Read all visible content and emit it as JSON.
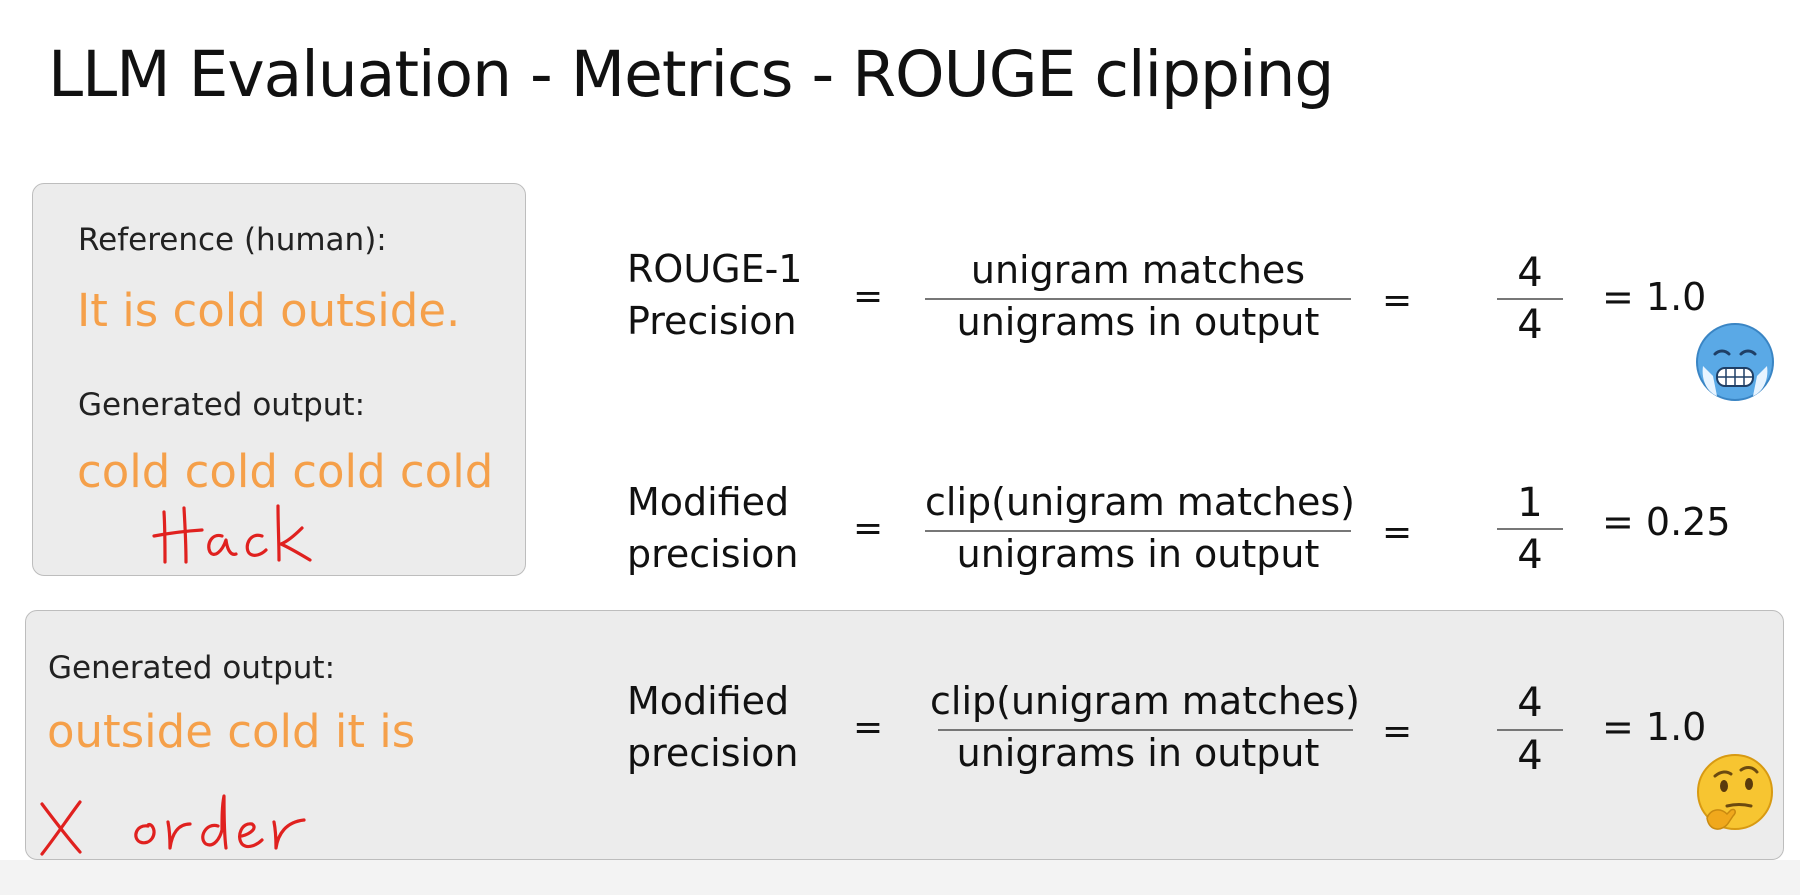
{
  "title": "LLM Evaluation - Metrics - ROUGE clipping",
  "top_box": {
    "reference_label": "Reference (human):",
    "reference_text": "It is cold outside.",
    "generated_label": "Generated output:",
    "generated_text": "cold cold cold cold",
    "annotation": "Hack"
  },
  "bottom_box": {
    "generated_label": "Generated output:",
    "generated_text": "outside cold it is",
    "annotation": "X order"
  },
  "rows": [
    {
      "label_line1": "ROUGE-1",
      "label_line2": "Precision",
      "equals": "=",
      "numerator": "unigram matches",
      "denominator": "unigrams in output",
      "equals2": "=",
      "num_value": "4",
      "den_value": "4",
      "result": "= 1.0",
      "emoji": "cold-face-emoji"
    },
    {
      "label_line1": "Modified",
      "label_line2": "precision",
      "equals": "=",
      "numerator": "clip(unigram matches)",
      "denominator": "unigrams in output",
      "equals2": "=",
      "num_value": "1",
      "den_value": "4",
      "result": "= 0.25"
    },
    {
      "label_line1": "Modified",
      "label_line2": "precision",
      "equals": "=",
      "numerator": "clip(unigram matches)",
      "denominator": "unigrams in output",
      "equals2": "=",
      "num_value": "4",
      "den_value": "4",
      "result": "= 1.0",
      "emoji": "thinking-face-emoji"
    }
  ],
  "colors": {
    "highlight_text": "#f5a04a",
    "handwriting": "#e0211f",
    "panel_background": "#ececec",
    "panel_border": "#bdbdbd"
  }
}
